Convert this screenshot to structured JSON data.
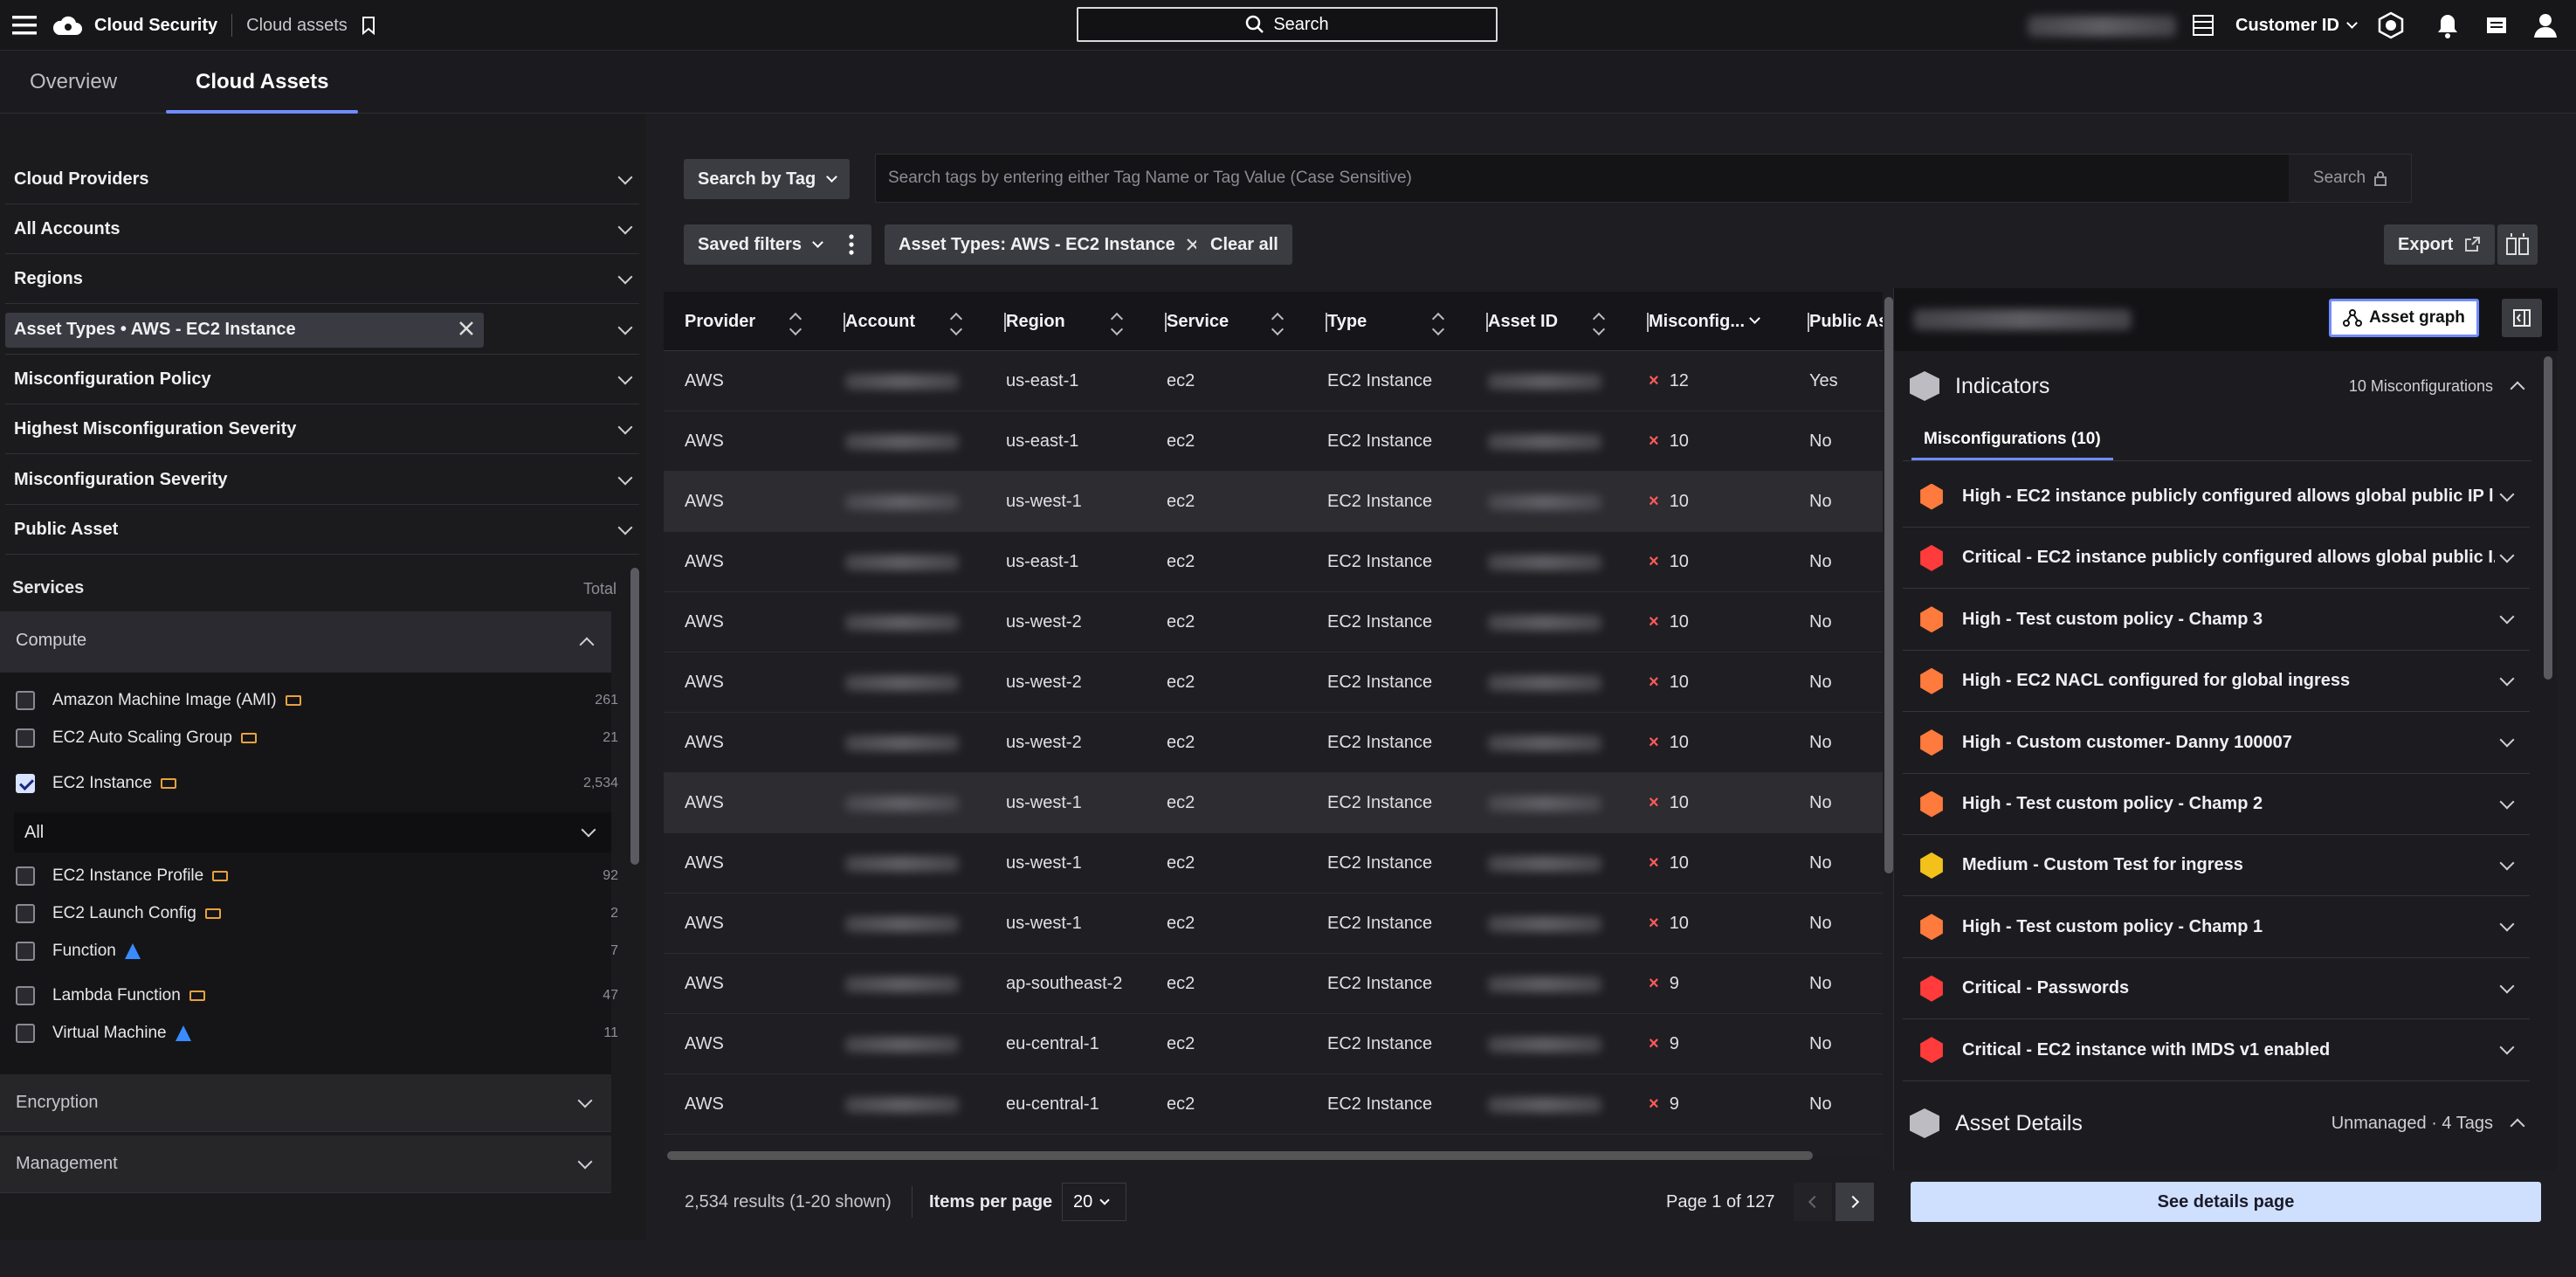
{
  "topbar": {
    "app_name": "Cloud Security",
    "breadcrumb": "Cloud assets",
    "search_label": "Search",
    "customer_label": "Customer ID"
  },
  "tabs": [
    "Overview",
    "Cloud Assets"
  ],
  "filters": {
    "rows": [
      "Cloud Providers",
      "All Accounts",
      "Regions",
      "Asset Types • AWS - EC2 Instance",
      "Misconfiguration Policy",
      "Highest Misconfiguration Severity",
      "Misconfiguration Severity",
      "Public Asset"
    ],
    "services_label": "Services",
    "total_label": "Total",
    "compute_label": "Compute",
    "services": [
      {
        "name": "Amazon Machine Image (AMI)",
        "count": "261",
        "provider": "aws",
        "checked": false
      },
      {
        "name": "EC2 Auto Scaling Group",
        "count": "21",
        "provider": "aws",
        "checked": false
      },
      {
        "name": "EC2 Instance",
        "count": "2,534",
        "provider": "aws",
        "checked": true
      },
      {
        "name": "EC2 Instance Profile",
        "count": "92",
        "provider": "aws",
        "checked": false
      },
      {
        "name": "EC2 Launch Config",
        "count": "2",
        "provider": "aws",
        "checked": false
      },
      {
        "name": "Function",
        "count": "7",
        "provider": "azure",
        "checked": false
      },
      {
        "name": "Lambda Function",
        "count": "47",
        "provider": "aws",
        "checked": false
      },
      {
        "name": "Virtual Machine",
        "count": "11",
        "provider": "azure",
        "checked": false
      }
    ],
    "subselect_value": "All",
    "groups": [
      "Encryption",
      "Management"
    ]
  },
  "toolbar": {
    "search_by_tag": "Search by Tag",
    "tag_placeholder": "Search tags by entering either Tag Name or Tag Value (Case Sensitive)",
    "search_button": "Search",
    "saved_filters": "Saved filters",
    "active_filter": "Asset Types: AWS - EC2 Instance",
    "clear_all": "Clear all",
    "export": "Export"
  },
  "table": {
    "columns": [
      "Provider",
      "Account",
      "Region",
      "Service",
      "Type",
      "Asset ID",
      "Misconfig...",
      "Public As"
    ],
    "rows": [
      {
        "provider": "AWS",
        "region": "us-east-1",
        "service": "ec2",
        "type": "EC2 Instance",
        "misconfig": "12",
        "public": "Yes"
      },
      {
        "provider": "AWS",
        "region": "us-east-1",
        "service": "ec2",
        "type": "EC2 Instance",
        "misconfig": "10",
        "public": "No"
      },
      {
        "provider": "AWS",
        "region": "us-west-1",
        "service": "ec2",
        "type": "EC2 Instance",
        "misconfig": "10",
        "public": "No"
      },
      {
        "provider": "AWS",
        "region": "us-east-1",
        "service": "ec2",
        "type": "EC2 Instance",
        "misconfig": "10",
        "public": "No"
      },
      {
        "provider": "AWS",
        "region": "us-west-2",
        "service": "ec2",
        "type": "EC2 Instance",
        "misconfig": "10",
        "public": "No"
      },
      {
        "provider": "AWS",
        "region": "us-west-2",
        "service": "ec2",
        "type": "EC2 Instance",
        "misconfig": "10",
        "public": "No"
      },
      {
        "provider": "AWS",
        "region": "us-west-2",
        "service": "ec2",
        "type": "EC2 Instance",
        "misconfig": "10",
        "public": "No"
      },
      {
        "provider": "AWS",
        "region": "us-west-1",
        "service": "ec2",
        "type": "EC2 Instance",
        "misconfig": "10",
        "public": "No"
      },
      {
        "provider": "AWS",
        "region": "us-west-1",
        "service": "ec2",
        "type": "EC2 Instance",
        "misconfig": "10",
        "public": "No"
      },
      {
        "provider": "AWS",
        "region": "us-west-1",
        "service": "ec2",
        "type": "EC2 Instance",
        "misconfig": "10",
        "public": "No"
      },
      {
        "provider": "AWS",
        "region": "ap-southeast-2",
        "service": "ec2",
        "type": "EC2 Instance",
        "misconfig": "9",
        "public": "No"
      },
      {
        "provider": "AWS",
        "region": "eu-central-1",
        "service": "ec2",
        "type": "EC2 Instance",
        "misconfig": "9",
        "public": "No"
      },
      {
        "provider": "AWS",
        "region": "eu-central-1",
        "service": "ec2",
        "type": "EC2 Instance",
        "misconfig": "9",
        "public": "No"
      }
    ]
  },
  "footer": {
    "results": "2,534 results (1-20 shown)",
    "items_per_page_label": "Items per page",
    "items_per_page": "20",
    "page_info": "Page 1 of 127"
  },
  "detail": {
    "asset_graph": "Asset graph",
    "indicators_title": "Indicators",
    "indicators_summary": "10 Misconfigurations",
    "misconfig_tab": "Misconfigurations (10)",
    "misconfigs": [
      {
        "label": "High - EC2 instance publicly configured allows global public IP l...",
        "severity": "high"
      },
      {
        "label": "Critical - EC2 instance publicly configured allows global public I...",
        "severity": "critical"
      },
      {
        "label": "High - Test custom policy - Champ 3",
        "severity": "high"
      },
      {
        "label": "High - EC2 NACL configured for global ingress",
        "severity": "high"
      },
      {
        "label": "High - Custom customer- Danny 100007",
        "severity": "high"
      },
      {
        "label": "High - Test custom policy - Champ 2",
        "severity": "high"
      },
      {
        "label": "Medium - Custom Test for ingress",
        "severity": "medium"
      },
      {
        "label": "High - Test custom policy - Champ 1",
        "severity": "high"
      },
      {
        "label": "Critical - Passwords",
        "severity": "critical"
      },
      {
        "label": "Critical - EC2 instance with IMDS v1 enabled",
        "severity": "critical"
      }
    ],
    "asset_details_title": "Asset Details",
    "asset_details_summary": "Unmanaged · 4 Tags",
    "see_details": "See details page"
  },
  "colors": {
    "accent": "#6f8cff",
    "high": "#ff7a3d",
    "critical": "#ff3b3b",
    "medium": "#f2c21b",
    "error_x": "#ff5a5a"
  }
}
